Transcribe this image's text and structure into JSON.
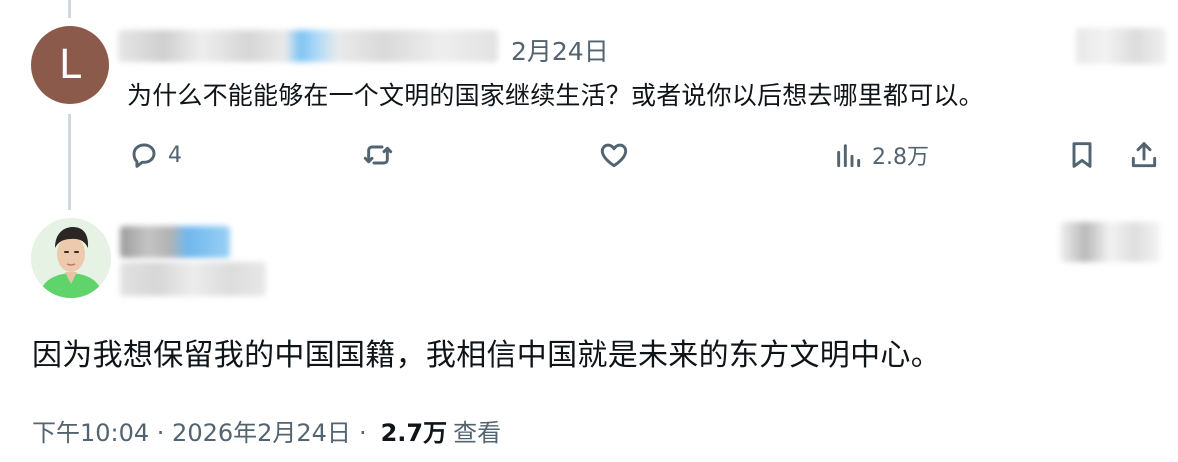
{
  "reply": {
    "avatar_letter": "L",
    "date": "2月24日",
    "text": "为什么不能能够在一个文明的国家继续生活？或者说你以后想去哪里都可以。",
    "actions": {
      "reply_count": "4",
      "repost_count": "",
      "like_count": "",
      "views_count": "2.8万"
    }
  },
  "main_post": {
    "text": "因为我想保留我的中国国籍，我相信中国就是未来的东方文明中心。",
    "timestamp": "下午10:04 · 2026年2月24日",
    "views_value": "2.7万",
    "views_label": "查看"
  },
  "colors": {
    "text_primary": "#0f1419",
    "text_secondary": "#536471",
    "thread_line": "#cfd9de",
    "avatar_bg": "#8b5a4b"
  }
}
